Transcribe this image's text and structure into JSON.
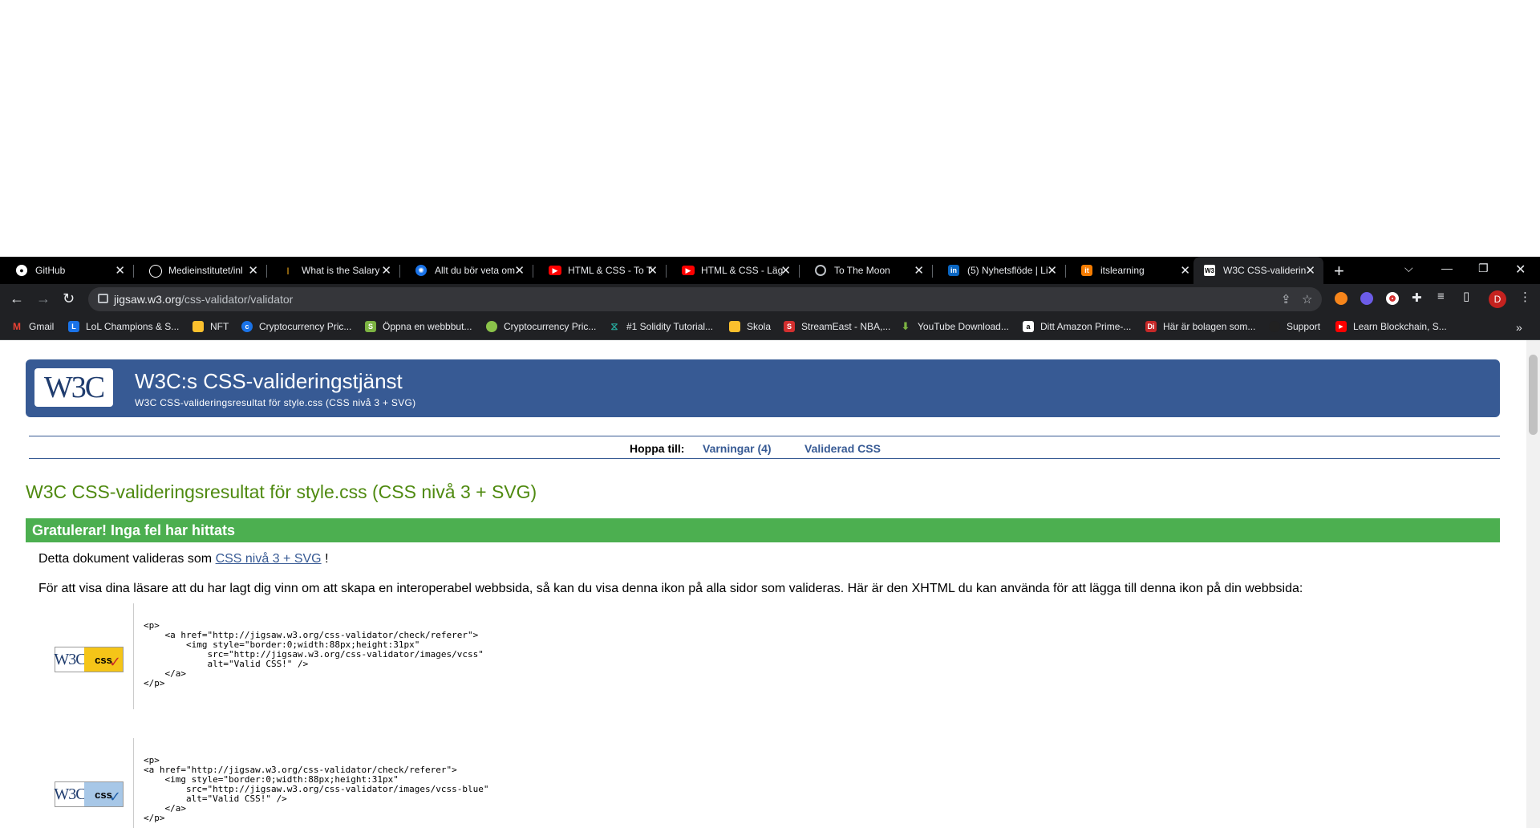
{
  "tabs": [
    {
      "title": "GitHub",
      "icon": "github-icon",
      "color": "#ffffff"
    },
    {
      "title": "Medieinstitutet/inl",
      "icon": "github-icon",
      "color": "#ffffff"
    },
    {
      "title": "What is the Salary",
      "icon": "dollar-icon",
      "color": "#e8a317"
    },
    {
      "title": "Allt du bör veta om",
      "icon": "globe-icon",
      "color": "#1a73e8"
    },
    {
      "title": "HTML & CSS - To T",
      "icon": "youtube-icon",
      "color": "#ff0000"
    },
    {
      "title": "HTML & CSS - Läg",
      "icon": "youtube-icon",
      "color": "#ff0000"
    },
    {
      "title": "To The Moon",
      "icon": "globe-icon",
      "color": "#bdc1c6"
    },
    {
      "title": "(5) Nyhetsflöde | Li",
      "icon": "linkedin-icon",
      "color": "#0a66c2"
    },
    {
      "title": "itslearning",
      "icon": "itslearning-icon",
      "color": "#f57c00"
    },
    {
      "title": "W3C CSS-validerin",
      "icon": "w3c-icon",
      "color": "#ffffff"
    }
  ],
  "address": {
    "host": "jigsaw.w3.org",
    "path": "/css-validator/validator"
  },
  "bookmarks": [
    {
      "label": "Gmail",
      "color": "#ea4335"
    },
    {
      "label": "LoL Champions & S...",
      "color": "#1a73e8"
    },
    {
      "label": "NFT",
      "color": "#fbc02d"
    },
    {
      "label": "Cryptocurrency Pric...",
      "color": "#1a73e8"
    },
    {
      "label": "Öppna en webbbut...",
      "color": "#7cb342"
    },
    {
      "label": "Cryptocurrency Pric...",
      "color": "#8bc34a"
    },
    {
      "label": "#1 Solidity Tutorial...",
      "color": "#26a69a"
    },
    {
      "label": "Skola",
      "color": "#fbc02d"
    },
    {
      "label": "StreamEast - NBA,...",
      "color": "#d32f2f"
    },
    {
      "label": "YouTube Download...",
      "color": "#7cb342"
    },
    {
      "label": "Ditt Amazon Prime-...",
      "color": "#ffffff"
    },
    {
      "label": "Här är bolagen som...",
      "color": "#c62828"
    },
    {
      "label": "Support",
      "color": "#212121"
    },
    {
      "label": "Learn Blockchain, S...",
      "color": "#ff0000"
    }
  ],
  "page": {
    "logo_text": "W3C",
    "title": "W3C:s CSS-valideringstjänst",
    "subtitle": "W3C CSS-valideringsresultat för style.css (CSS nivå 3 + SVG)",
    "jump_label": "Hoppa till:",
    "jump_warnings": "Varningar (4)",
    "jump_validated": "Validerad CSS",
    "result_heading": "W3C CSS-valideringsresultat för style.css (CSS nivå 3 + SVG)",
    "congrats": "Gratulerar! Inga fel har hittats",
    "validated_as_prefix": "Detta dokument valideras som",
    "validated_as_link": "CSS nivå 3 + SVG",
    "validated_as_suffix": "!",
    "icon_info": "För att visa dina läsare att du har lagt dig vinn om att skapa en interoperabel webbsida, så kan du visa denna ikon på alla sidor som valideras. Här är den XHTML du kan använda för att lägga till denna ikon på din webbsida:",
    "badge1": {
      "w3": "W3C",
      "css": "css",
      "bg": "#f5c518",
      "check_color": "#c62828"
    },
    "badge2": {
      "w3": "W3C",
      "css": "css",
      "bg": "#a7c7e7",
      "check_color": "#1f5fa8"
    },
    "code1": "<p>\n    <a href=\"http://jigsaw.w3.org/css-validator/check/referer\">\n        <img style=\"border:0;width:88px;height:31px\"\n            src=\"http://jigsaw.w3.org/css-validator/images/vcss\"\n            alt=\"Valid CSS!\" />\n    </a>\n</p>",
    "code2": "<p>\n<a href=\"http://jigsaw.w3.org/css-validator/check/referer\">\n    <img style=\"border:0;width:88px;height:31px\"\n        src=\"http://jigsaw.w3.org/css-validator/images/vcss-blue\"\n        alt=\"Valid CSS!\" />\n    </a>\n</p>"
  },
  "profile_initial": "D"
}
